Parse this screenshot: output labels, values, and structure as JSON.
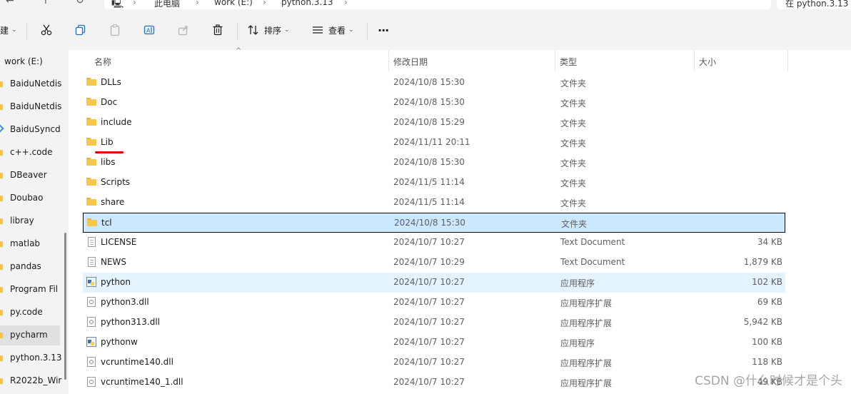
{
  "topbar": {
    "breadcrumb": [
      "此电脑",
      "work (E:)",
      "python.3.13"
    ],
    "search_placeholder": "在 python.3.13"
  },
  "toolbar": {
    "new_label": "建",
    "sort_label": "排序",
    "view_label": "查看",
    "more_label": "···"
  },
  "sidebar": {
    "drive": "work (E:)",
    "items": [
      {
        "label": "BaiduNetdis",
        "icon": "folder-icon"
      },
      {
        "label": "BaiduNetdis",
        "icon": "folder-icon"
      },
      {
        "label": "BaiduSyncd",
        "icon": "sync-icon"
      },
      {
        "label": "c++.code",
        "icon": "folder-icon"
      },
      {
        "label": "DBeaver",
        "icon": "folder-icon"
      },
      {
        "label": "Doubao",
        "icon": "folder-icon"
      },
      {
        "label": "libray",
        "icon": "folder-icon"
      },
      {
        "label": "matlab",
        "icon": "folder-icon"
      },
      {
        "label": "pandas",
        "icon": "folder-icon"
      },
      {
        "label": "Program Fil",
        "icon": "folder-icon"
      },
      {
        "label": "py.code",
        "icon": "folder-icon"
      },
      {
        "label": "pycharm",
        "icon": "folder-icon"
      },
      {
        "label": "python.3.13",
        "icon": "folder-icon"
      },
      {
        "label": "R2022b_Wir",
        "icon": "folder-icon"
      }
    ]
  },
  "columns": {
    "name": "名称",
    "date": "修改日期",
    "type": "类型",
    "size": "大小"
  },
  "files": [
    {
      "name": "DLLs",
      "date": "2024/10/8 15:30",
      "type": "文件夹",
      "size": "",
      "icon": "folder-icon"
    },
    {
      "name": "Doc",
      "date": "2024/10/8 15:30",
      "type": "文件夹",
      "size": "",
      "icon": "folder-icon"
    },
    {
      "name": "include",
      "date": "2024/10/8 15:29",
      "type": "文件夹",
      "size": "",
      "icon": "folder-icon"
    },
    {
      "name": "Lib",
      "date": "2024/11/11 20:11",
      "type": "文件夹",
      "size": "",
      "icon": "folder-icon"
    },
    {
      "name": "libs",
      "date": "2024/10/8 15:30",
      "type": "文件夹",
      "size": "",
      "icon": "folder-icon"
    },
    {
      "name": "Scripts",
      "date": "2024/11/5 11:14",
      "type": "文件夹",
      "size": "",
      "icon": "folder-icon"
    },
    {
      "name": "share",
      "date": "2024/11/5 11:14",
      "type": "文件夹",
      "size": "",
      "icon": "folder-icon"
    },
    {
      "name": "tcl",
      "date": "2024/10/8 15:30",
      "type": "文件夹",
      "size": "",
      "icon": "folder-icon"
    },
    {
      "name": "LICENSE",
      "date": "2024/10/7 10:27",
      "type": "Text Document",
      "size": "34 KB",
      "icon": "text-file-icon"
    },
    {
      "name": "NEWS",
      "date": "2024/10/7 10:29",
      "type": "Text Document",
      "size": "1,879 KB",
      "icon": "text-file-icon"
    },
    {
      "name": "python",
      "date": "2024/10/7 10:27",
      "type": "应用程序",
      "size": "102 KB",
      "icon": "python-app-icon"
    },
    {
      "name": "python3.dll",
      "date": "2024/10/7 10:27",
      "type": "应用程序扩展",
      "size": "69 KB",
      "icon": "dll-file-icon"
    },
    {
      "name": "python313.dll",
      "date": "2024/10/7 10:27",
      "type": "应用程序扩展",
      "size": "5,942 KB",
      "icon": "dll-file-icon"
    },
    {
      "name": "pythonw",
      "date": "2024/10/7 10:27",
      "type": "应用程序",
      "size": "100 KB",
      "icon": "python-app-icon"
    },
    {
      "name": "vcruntime140.dll",
      "date": "2024/10/7 10:27",
      "type": "应用程序扩展",
      "size": "118 KB",
      "icon": "dll-file-icon"
    },
    {
      "name": "vcruntime140_1.dll",
      "date": "2024/10/7 10:27",
      "type": "应用程序扩展",
      "size": "49 KB",
      "icon": "dll-file-icon"
    }
  ],
  "watermark": "CSDN @什么时候才是个头",
  "colors": {
    "selection": "#cce8ff",
    "hover": "#e5f3ff",
    "annotation": "#e00000",
    "folder": "#f5c84c"
  }
}
